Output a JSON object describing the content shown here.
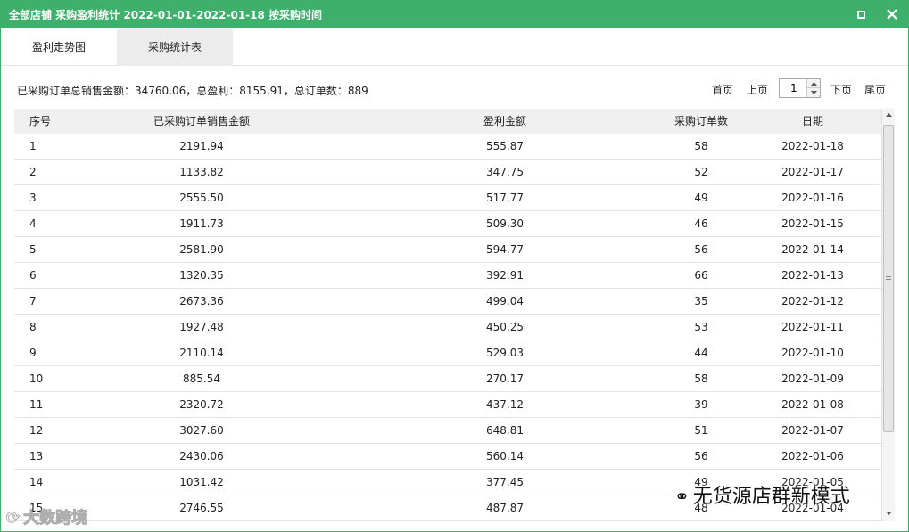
{
  "window": {
    "title": "全部店铺 采购盈利统计 2022-01-01-2022-01-18 按采购时间",
    "maximize_icon": "maximize-icon",
    "close_icon": "close-icon"
  },
  "tabs": [
    {
      "label": "盈利走势图",
      "active": false
    },
    {
      "label": "采购统计表",
      "active": true
    }
  ],
  "summary": "已采购订单总销售金额：34760.06，总盈利：8155.91，总订单数：889",
  "pager": {
    "first": "首页",
    "prev": "上页",
    "page_value": "1",
    "next": "下页",
    "last": "尾页"
  },
  "table": {
    "headers": {
      "idx": "序号",
      "sales": "已采购订单销售金额",
      "profit": "盈利金额",
      "orders": "采购订单数",
      "date": "日期"
    },
    "rows": [
      {
        "idx": "1",
        "sales": "2191.94",
        "profit": "555.87",
        "orders": "58",
        "date": "2022-01-18"
      },
      {
        "idx": "2",
        "sales": "1133.82",
        "profit": "347.75",
        "orders": "52",
        "date": "2022-01-17"
      },
      {
        "idx": "3",
        "sales": "2555.50",
        "profit": "517.77",
        "orders": "49",
        "date": "2022-01-16"
      },
      {
        "idx": "4",
        "sales": "1911.73",
        "profit": "509.30",
        "orders": "46",
        "date": "2022-01-15"
      },
      {
        "idx": "5",
        "sales": "2581.90",
        "profit": "594.77",
        "orders": "56",
        "date": "2022-01-14"
      },
      {
        "idx": "6",
        "sales": "1320.35",
        "profit": "392.91",
        "orders": "66",
        "date": "2022-01-13"
      },
      {
        "idx": "7",
        "sales": "2673.36",
        "profit": "499.04",
        "orders": "35",
        "date": "2022-01-12"
      },
      {
        "idx": "8",
        "sales": "1927.48",
        "profit": "450.25",
        "orders": "53",
        "date": "2022-01-11"
      },
      {
        "idx": "9",
        "sales": "2110.14",
        "profit": "529.03",
        "orders": "44",
        "date": "2022-01-10"
      },
      {
        "idx": "10",
        "sales": "885.54",
        "profit": "270.17",
        "orders": "58",
        "date": "2022-01-09"
      },
      {
        "idx": "11",
        "sales": "2320.72",
        "profit": "437.12",
        "orders": "39",
        "date": "2022-01-08"
      },
      {
        "idx": "12",
        "sales": "3027.60",
        "profit": "648.81",
        "orders": "51",
        "date": "2022-01-07"
      },
      {
        "idx": "13",
        "sales": "2430.06",
        "profit": "560.14",
        "orders": "56",
        "date": "2022-01-06"
      },
      {
        "idx": "14",
        "sales": "1031.42",
        "profit": "377.45",
        "orders": "49",
        "date": "2022-01-05"
      },
      {
        "idx": "15",
        "sales": "2746.55",
        "profit": "487.87",
        "orders": "48",
        "date": "2022-01-04"
      }
    ]
  },
  "watermarks": {
    "left": "大数跨境",
    "right": "无货源店群新模式"
  },
  "colors": {
    "titlebar": "#3fb06b",
    "active_tab": "#ececec",
    "header_row": "#f0f0f0"
  }
}
